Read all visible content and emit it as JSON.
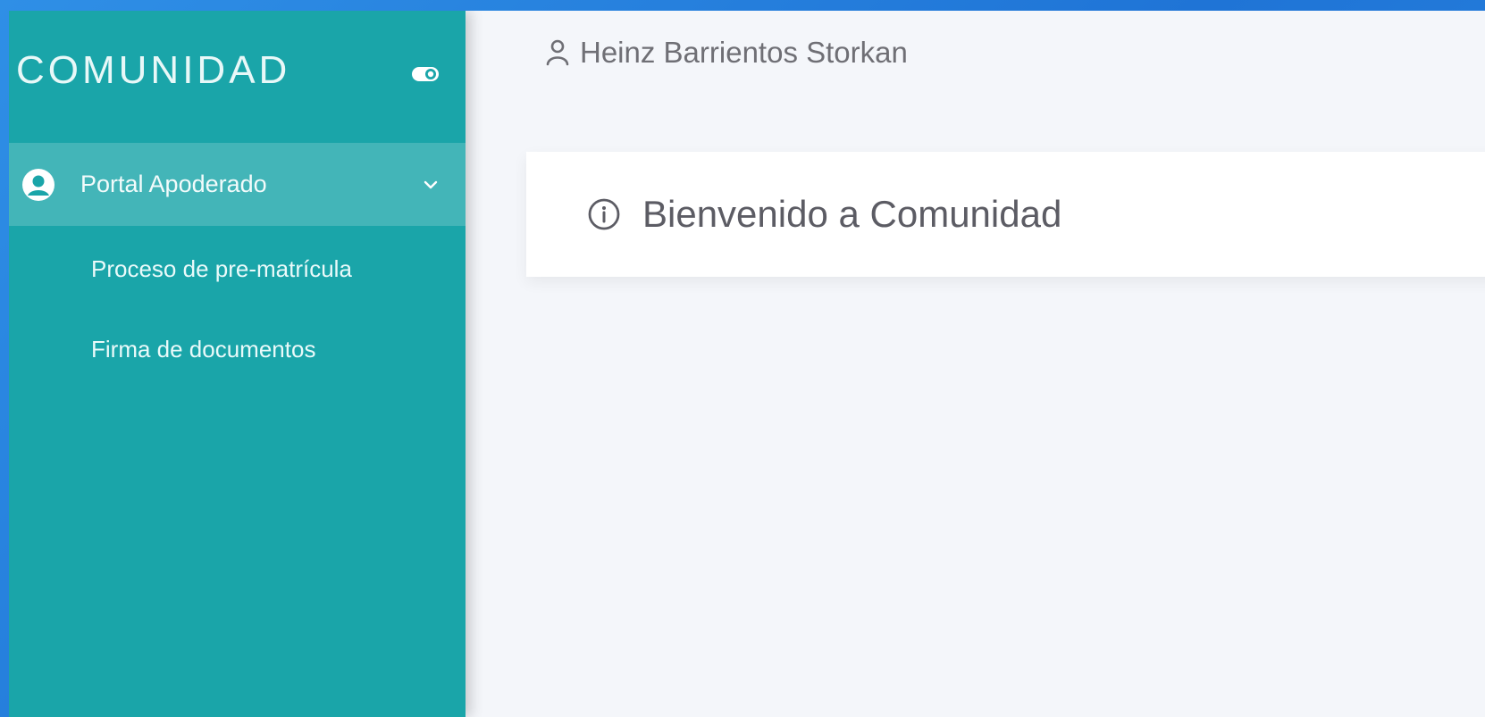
{
  "sidebar": {
    "brand": "COMUNIDAD",
    "group": {
      "label": "Portal Apoderado"
    },
    "items": [
      {
        "label": "Proceso de pre-matrícula"
      },
      {
        "label": "Firma de documentos"
      }
    ]
  },
  "header": {
    "user_name": "Heinz Barrientos Storkan"
  },
  "main": {
    "welcome_title": "Bienvenido a Comunidad"
  },
  "colors": {
    "sidebar": "#1aa5a9",
    "background": "#f4f6fa",
    "card": "#ffffff",
    "frame_bg": "#1f74d6"
  },
  "icons": [
    "toggle-icon",
    "user-circle-icon",
    "chevron-down-icon",
    "user-icon",
    "info-icon"
  ]
}
